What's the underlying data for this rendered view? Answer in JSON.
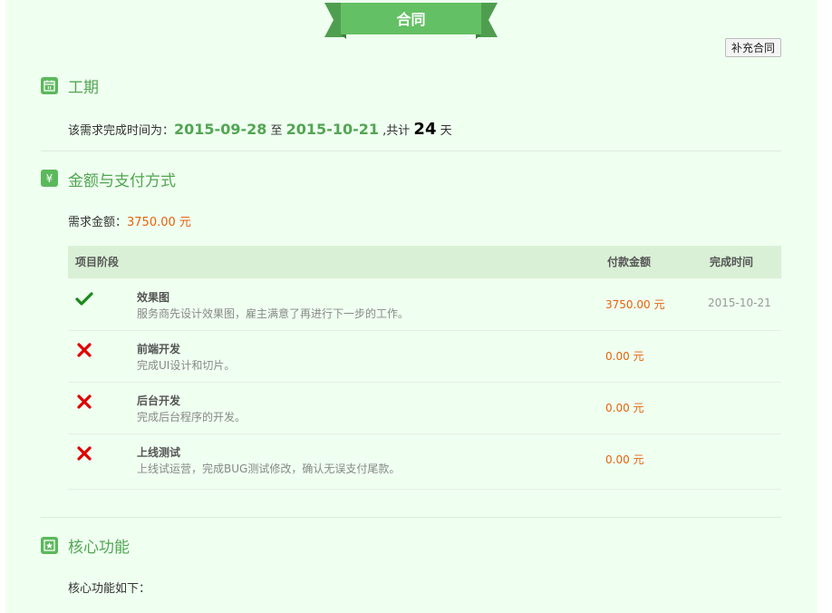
{
  "header": {
    "title": "合同",
    "supplement_button": "补充合同"
  },
  "schedule": {
    "title": "工期",
    "icon": "calendar-icon",
    "prefix": "该需求完成时间为：",
    "start": "2015-09-28",
    "to": "至",
    "end": "2015-10-21",
    "total_prefix": ",共计",
    "days": "24",
    "days_unit": "天"
  },
  "payment": {
    "title": "金额与支付方式",
    "icon": "yen-icon",
    "amount_label": "需求金额：",
    "amount_value": "3750.00 元",
    "table": {
      "headers": {
        "stage": "项目阶段",
        "amount": "付款金额",
        "done_time": "完成时间"
      },
      "rows": [
        {
          "status": "completed",
          "name": "效果图",
          "desc": "服务商先设计效果图，雇主满意了再进行下一步的工作。",
          "amount": "3750.00 元",
          "done_time": "2015-10-21"
        },
        {
          "status": "pending",
          "name": "前端开发",
          "desc": "完成UI设计和切片。",
          "amount": "0.00 元",
          "done_time": ""
        },
        {
          "status": "pending",
          "name": "后台开发",
          "desc": "完成后台程序的开发。",
          "amount": "0.00 元",
          "done_time": ""
        },
        {
          "status": "pending",
          "name": "上线测试",
          "desc": "上线试运营，完成BUG测试修改，确认无误支付尾款。",
          "amount": "0.00 元",
          "done_time": ""
        }
      ]
    }
  },
  "core": {
    "title": "核心功能",
    "icon": "star-icon",
    "intro": "核心功能如下："
  },
  "colors": {
    "accent": "#5cb85c",
    "title_green": "#52a552",
    "orange": "#e8620b",
    "panel_bg": "#effff0",
    "check": "#1a8a1a",
    "cross": "#e00000"
  }
}
